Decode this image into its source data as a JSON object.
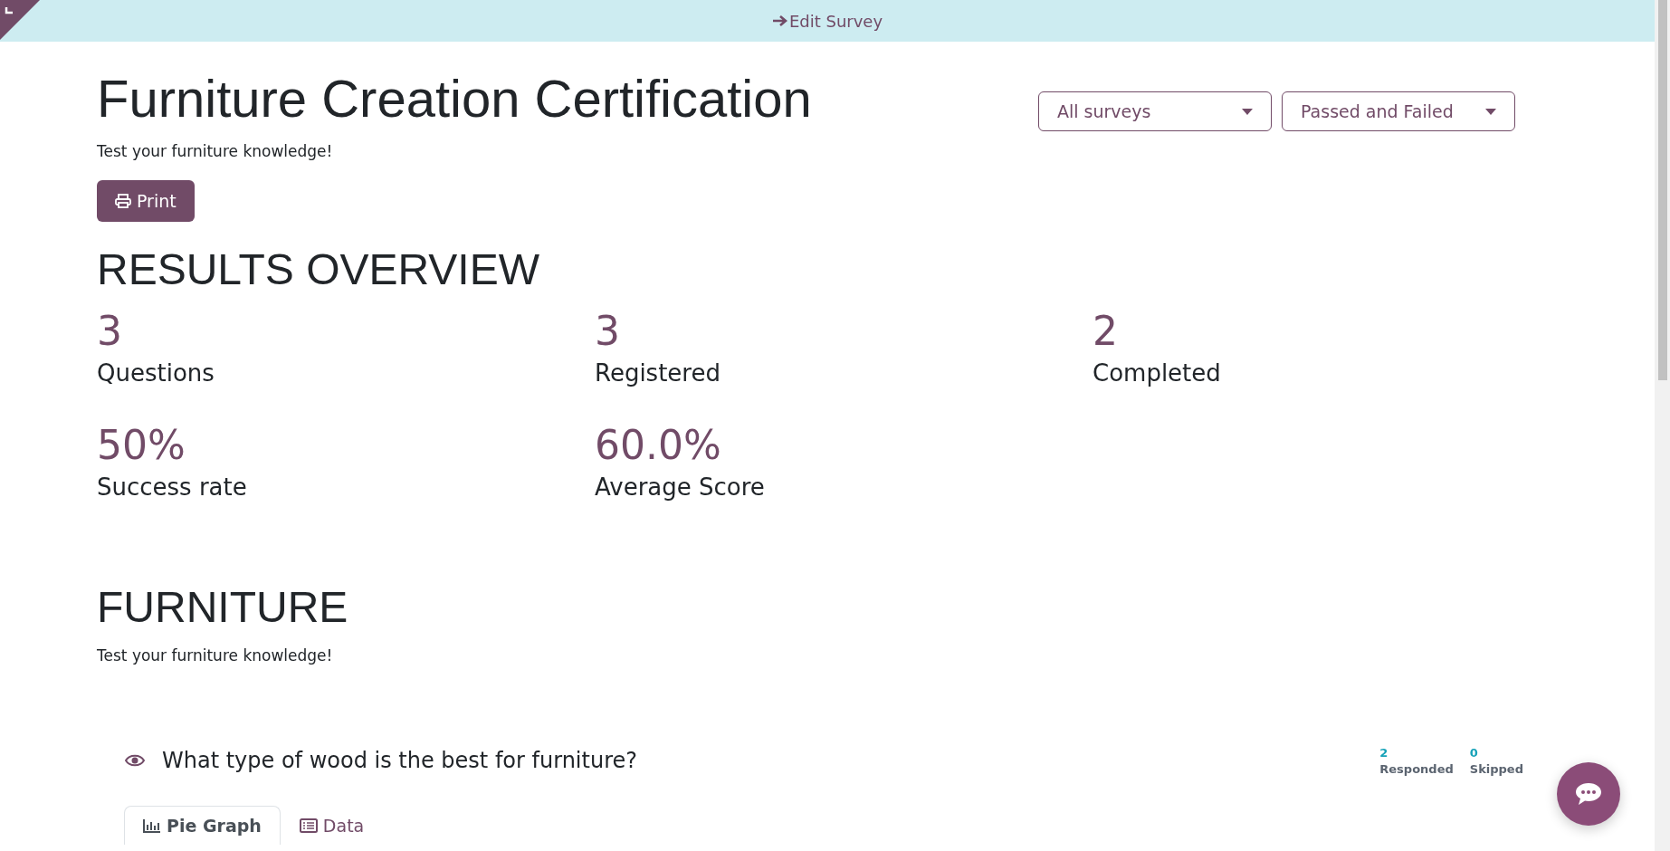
{
  "top_bar": {
    "link": "Edit Survey"
  },
  "survey": {
    "title": "Furniture Creation Certification",
    "description": "Test your furniture knowledge!"
  },
  "filters": [
    {
      "label": "All surveys"
    },
    {
      "label": "Passed and Failed"
    }
  ],
  "print_button": "Print",
  "overview": {
    "heading": "RESULTS OVERVIEW",
    "stats": [
      {
        "value": "3",
        "label": "Questions"
      },
      {
        "value": "3",
        "label": "Registered"
      },
      {
        "value": "2",
        "label": "Completed"
      },
      {
        "value": "50%",
        "label": "Success rate"
      },
      {
        "value": "60.0%",
        "label": "Average Score"
      }
    ]
  },
  "section": {
    "heading": "FURNITURE",
    "description": "Test your furniture knowledge!"
  },
  "question": {
    "title": "What type of wood is the best for furniture?",
    "counts": [
      {
        "value": "2",
        "label": "Responded"
      },
      {
        "value": "0",
        "label": "Skipped"
      }
    ],
    "tabs": [
      {
        "label": "Pie Graph",
        "kind": "chart",
        "selected": true
      },
      {
        "label": "Data",
        "kind": "table",
        "selected": false
      }
    ]
  }
}
